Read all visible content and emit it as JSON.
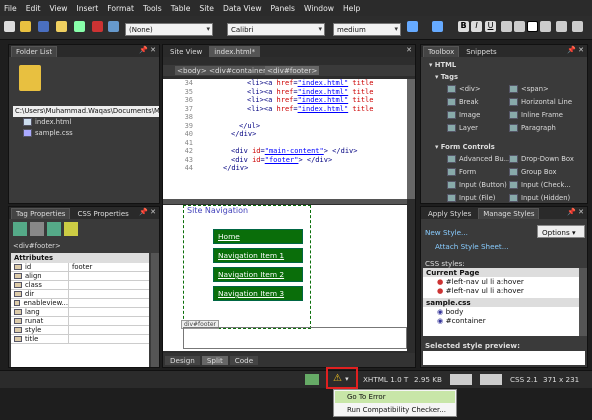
{
  "menu": [
    "File",
    "Edit",
    "View",
    "Insert",
    "Format",
    "Tools",
    "Table",
    "Site",
    "Data View",
    "Panels",
    "Window",
    "Help"
  ],
  "toolbar": {
    "style_combo": "(None)",
    "font_combo": "Calibri",
    "size_combo": "medium"
  },
  "folder_list": {
    "title": "Folder List",
    "path": "C:\\Users\\Muhammad.Waqas\\Documents\\M",
    "files": [
      "index.html",
      "sample.css"
    ]
  },
  "editor": {
    "tabs": [
      "Site View",
      "index.html*"
    ],
    "breadcrumbs": [
      "<body>",
      "<div#container>",
      "<div#footer>"
    ],
    "code_lines": [
      {
        "n": "34",
        "parts": [
          [
            "t",
            "<li><a "
          ],
          [
            "a",
            "href"
          ],
          [
            "t",
            "="
          ],
          [
            "v",
            "\"index.html\""
          ],
          [
            "a",
            " title"
          ]
        ]
      },
      {
        "n": "35",
        "parts": [
          [
            "t",
            "<li><a "
          ],
          [
            "a",
            "href"
          ],
          [
            "t",
            "="
          ],
          [
            "v",
            "\"index.html\""
          ],
          [
            "a",
            " title"
          ]
        ]
      },
      {
        "n": "36",
        "parts": [
          [
            "t",
            "<li><a "
          ],
          [
            "a",
            "href"
          ],
          [
            "t",
            "="
          ],
          [
            "v",
            "\"index.html\""
          ],
          [
            "a",
            " title"
          ]
        ]
      },
      {
        "n": "37",
        "parts": [
          [
            "t",
            "<li><a "
          ],
          [
            "a",
            "href"
          ],
          [
            "t",
            "="
          ],
          [
            "v",
            "\"index.html\""
          ],
          [
            "a",
            " title"
          ]
        ]
      },
      {
        "n": "38",
        "parts": []
      },
      {
        "n": "39",
        "parts": [
          [
            "t",
            "</ul>"
          ]
        ]
      },
      {
        "n": "40",
        "parts": [
          [
            "t",
            "</div>"
          ]
        ]
      },
      {
        "n": "41",
        "parts": []
      },
      {
        "n": "42",
        "parts": [
          [
            "t",
            "<div "
          ],
          [
            "a",
            "id"
          ],
          [
            "t",
            "="
          ],
          [
            "v",
            "\"main-content\""
          ],
          [
            "t",
            "> </div>"
          ]
        ]
      },
      {
        "n": "43",
        "parts": [
          [
            "t",
            "<div "
          ],
          [
            "a",
            "id"
          ],
          [
            "t",
            "="
          ],
          [
            "v",
            "\"footer\""
          ],
          [
            "t",
            "> </div>"
          ]
        ]
      },
      {
        "n": "44",
        "parts": [
          [
            "t",
            "</div>"
          ]
        ]
      }
    ],
    "design_heading": "Site Navigation",
    "nav_buttons": [
      "Home",
      "Navigation Item 1",
      "Navigation Item 2",
      "Navigation Item 3"
    ],
    "footer_label": "div#footer",
    "view_tabs": [
      "Design",
      "Split",
      "Code"
    ]
  },
  "tag_properties": {
    "tabs": [
      "Tag Properties",
      "CSS Properties"
    ],
    "selected": "<div#footer>",
    "section": "Attributes",
    "rows": [
      [
        "id",
        "footer"
      ],
      [
        "align",
        ""
      ],
      [
        "class",
        ""
      ],
      [
        "dir",
        ""
      ],
      [
        "enableview...",
        ""
      ],
      [
        "lang",
        ""
      ],
      [
        "runat",
        ""
      ],
      [
        "style",
        ""
      ],
      [
        "title",
        ""
      ]
    ]
  },
  "toolbox": {
    "tabs": [
      "Toolbox",
      "Snippets"
    ],
    "html": "HTML",
    "tags": "Tags",
    "form_controls": "Form Controls",
    "tag_items": [
      "<div>",
      "<span>",
      "Break",
      "Horizontal Line",
      "Image",
      "Inline Frame",
      "Layer",
      "Paragraph"
    ],
    "form_items": [
      "Advanced Bu...",
      "Drop-Down Box",
      "Form",
      "Group Box",
      "Input (Button)",
      "Input (Check...",
      "Input (File)",
      "Input (Hidden)"
    ]
  },
  "styles": {
    "tabs": [
      "Apply Styles",
      "Manage Styles"
    ],
    "new_style": "New Style...",
    "options": "Options",
    "attach": "Attach Style Sheet...",
    "css_styles": "CSS styles:",
    "current_page": "Current Page",
    "rules_current": [
      "#left-nav ul li a:hover",
      "#left-nav ul li a:hover"
    ],
    "sheet": "sample.css",
    "rules_sheet": [
      "body",
      "#container"
    ],
    "preview": "Selected style preview:"
  },
  "status": {
    "doctype": "XHTML 1.0 T",
    "size": "2.95 KB",
    "css": "CSS 2.1",
    "dims": "371 x 231"
  },
  "popup": {
    "items": [
      "Go To Error",
      "Run Compatibility Checker..."
    ]
  },
  "colors": {
    "highlight": "#e02020",
    "nav_green": "#0a6e0a"
  }
}
